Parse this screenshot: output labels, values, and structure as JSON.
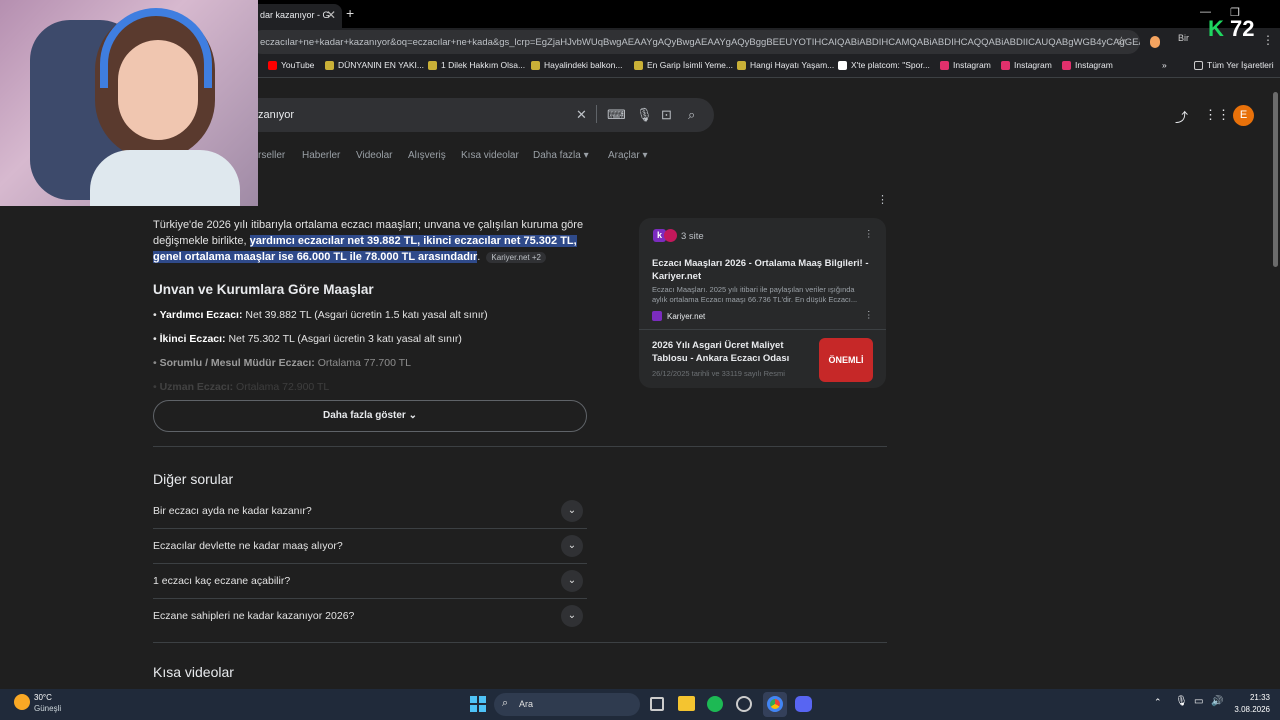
{
  "browser": {
    "tab_title": "dar kazanıyor - G",
    "url": "eczacılar+ne+kadar+kazanıyor&oq=eczacılar+ne+kada&gs_lcrp=EgZjaHJvbWUqBwgAEAAYgAQyBwgAEAAYgAQyBggBEEUYOTIHCAIQABiABDIHCAMQABiABDIHCAQQABiABDIICAUQABgWGB4yCAgGEAAYF...",
    "profile_badge": "Bir",
    "bookmarks": [
      {
        "label": "YouTube",
        "color": "#ff0000"
      },
      {
        "label": "DÜNYANIN EN YAKI...",
        "color": "#f5c518"
      },
      {
        "label": "1 Dilek Hakkım Olsa...",
        "color": "#f5c518"
      },
      {
        "label": "Hayalindeki balkon...",
        "color": "#f5c518"
      },
      {
        "label": "En Garip İsimli Yeme...",
        "color": "#f5c518"
      },
      {
        "label": "Hangi Hayatı Yaşam...",
        "color": "#f5c518"
      },
      {
        "label": "X'te platcom: \"Spor...",
        "color": "#ffffff"
      },
      {
        "label": "Instagram",
        "color": "#e1306c"
      },
      {
        "label": "Instagram",
        "color": "#e1306c"
      },
      {
        "label": "Instagram",
        "color": "#e1306c"
      }
    ],
    "all_bookmarks": "Tüm Yer İşaretleri"
  },
  "overlay": {
    "score": "72"
  },
  "search": {
    "query": "zanıyor",
    "tabs": [
      "rseller",
      "Haberler",
      "Videolar",
      "Alışveriş",
      "Kısa videolar",
      "Daha fazla",
      "Araçlar"
    ],
    "avatar": "E"
  },
  "answer": {
    "line1": "Türkiye'de 2026 yılı itibarıyla ortalama eczacı maaşları; unvana ve çalışılan kuruma göre",
    "line2_plain": "değişmekle birlikte, ",
    "line2_hl": "yardımcı eczacılar net 39.882 TL, ikinci eczacılar net 75.302 TL,",
    "line3_hl": "genel ortalama maaşlar ise 66.000 TL ile 78.000 TL arasındadır",
    "line3_end": ".",
    "source_chip": "Kariyer.net +2",
    "heading": "Unvan ve Kurumlara Göre Maaşlar",
    "bullets": [
      {
        "title": "Yardımcı Eczacı:",
        "text": " Net 39.882 TL (Asgari ücretin 1.5 katı yasal alt sınır)"
      },
      {
        "title": "İkinci Eczacı:",
        "text": " Net 75.302 TL (Asgari ücretin 3 katı yasal alt sınır)"
      },
      {
        "title": "Sorumlu / Mesul Müdür Eczacı:",
        "text": " Ortalama 77.700 TL"
      },
      {
        "title": "Uzman Eczacı:",
        "text": " Ortalama 72.900 TL"
      }
    ],
    "more_button": "Daha fazla göster"
  },
  "sources": {
    "count": "3 site",
    "items": [
      {
        "title": "Eczacı Maaşları 2026 - Ortalama Maaş Bilgileri! - Kariyer.net",
        "snippet": "Eczacı Maaşları. 2025 yılı itibari ile paylaşılan veriler ışığında aylık ortalama Eczacı maaşı 66.736 TL'dir. En düşük Eczacı...",
        "site": "Kariyer.net"
      },
      {
        "title": "2026 Yılı Asgari Ücret Maliyet Tablosu - Ankara Eczacı Odası",
        "snippet": "26/12/2025 tarihli ve 33119 sayılı Resmi",
        "thumb_text": "ÖNEMLİ"
      }
    ]
  },
  "faq": {
    "title": "Diğer sorular",
    "questions": [
      "Bir eczacı ayda ne kadar kazanır?",
      "Eczacılar devlette ne kadar maaş alıyor?",
      "1 eczacı kaç eczane açabilir?",
      "Eczane sahipleri ne kadar kazanıyor 2026?"
    ]
  },
  "short_videos": {
    "title": "Kısa videolar"
  },
  "taskbar": {
    "weather_temp": "30°C",
    "weather_desc": "Güneşli",
    "search_placeholder": "Ara",
    "time": "21:33",
    "date": "3.08.2026"
  }
}
